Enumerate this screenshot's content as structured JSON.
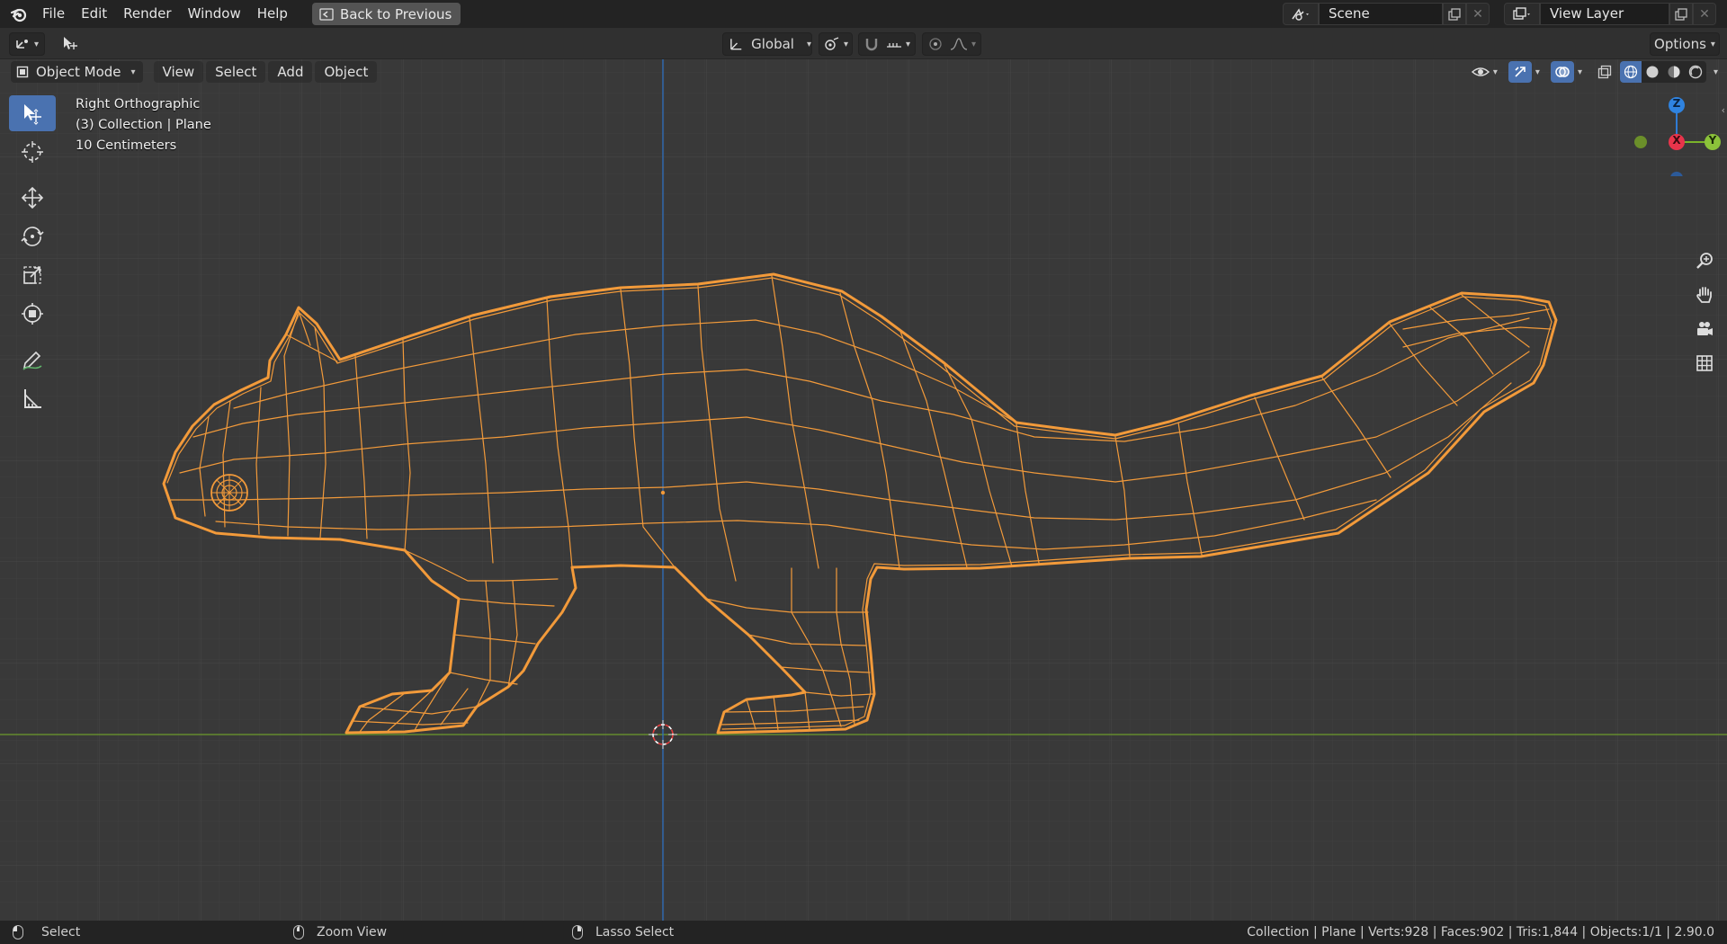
{
  "topbar": {
    "menus": [
      "File",
      "Edit",
      "Render",
      "Window",
      "Help"
    ],
    "back_button": "Back to Previous",
    "scene_name": "Scene",
    "view_layer_name": "View Layer"
  },
  "toolheader": {
    "transform_orientation": "Global",
    "options_label": "Options"
  },
  "viewport": {
    "mode": "Object Mode",
    "menus": [
      "View",
      "Select",
      "Add",
      "Object"
    ],
    "overlay": {
      "view_name": "Right Orthographic",
      "collection_info": "(3) Collection | Plane",
      "scale_info": "10 Centimeters"
    },
    "gizmo_axes": {
      "z": "Z",
      "x": "X",
      "y": "Y"
    },
    "colors": {
      "wire": "#f29a3a",
      "grid_major": "#4a4a4a",
      "x_axis_line": "#6d9a2c",
      "z_axis_line": "#2e6fbf",
      "active_tool": "#4a72b0"
    }
  },
  "statusbar": {
    "select": "Select",
    "zoom": "Zoom View",
    "lasso": "Lasso Select",
    "stats": "Collection | Plane | Verts:928 | Faces:902 | Tris:1,844 | Objects:1/1 | 2.90.0"
  }
}
